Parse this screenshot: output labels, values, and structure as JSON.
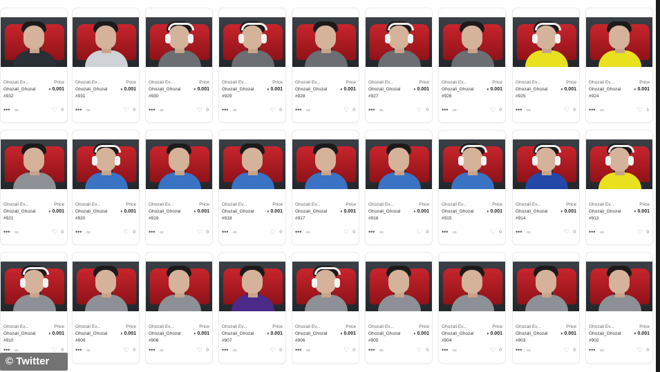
{
  "watermark": "© Twitter",
  "labels": {
    "price_label": "Price",
    "eth_icon": "ethereum-icon",
    "more_icon": "more-dots-icon",
    "link_icon": "link-icon",
    "heart_icon": "heart-icon"
  },
  "cards": [
    {
      "collection": "Ghozali Ev...",
      "owner": "Ghozali_Ghozal",
      "price": "0.001",
      "number": "#932",
      "likes": "0",
      "shirt": "#2b2f36",
      "headphones": false
    },
    {
      "collection": "Ghozali Ev...",
      "owner": "Ghozali_Ghozal",
      "price": "0.001",
      "number": "#931",
      "likes": "0",
      "shirt": "#cfd2d6",
      "headphones": false
    },
    {
      "collection": "Ghozali Ev...",
      "owner": "Ghozali_Ghozal",
      "price": "0.001",
      "number": "#930",
      "likes": "0",
      "shirt": "#6b6e72",
      "headphones": true
    },
    {
      "collection": "Ghozali Ev...",
      "owner": "Ghozali_Ghozal",
      "price": "0.001",
      "number": "#929",
      "likes": "0",
      "shirt": "#6b6e72",
      "headphones": true
    },
    {
      "collection": "Ghozali Ev...",
      "owner": "Ghozali_Ghozal",
      "price": "0.001",
      "number": "#928",
      "likes": "0",
      "shirt": "#6b6e72",
      "headphones": false
    },
    {
      "collection": "Ghozali Ev...",
      "owner": "Ghozali_Ghozal",
      "price": "0.001",
      "number": "#927",
      "likes": "0",
      "shirt": "#6b6e72",
      "headphones": true
    },
    {
      "collection": "Ghozali Ev...",
      "owner": "Ghozali_Ghozal",
      "price": "0.001",
      "number": "#926",
      "likes": "0",
      "shirt": "#6b6e72",
      "headphones": false
    },
    {
      "collection": "Ghozali Ev...",
      "owner": "Ghozali_Ghozal",
      "price": "0.001",
      "number": "#925",
      "likes": "0",
      "shirt": "#e9e11f",
      "headphones": true
    },
    {
      "collection": "Ghozali Ev...",
      "owner": "Ghozali_Ghozal",
      "price": "0.001",
      "number": "#924",
      "likes": "1",
      "shirt": "#e9e11f",
      "headphones": false
    },
    {
      "collection": "Ghozali Ev...",
      "owner": "Ghozali_Ghozal",
      "price": "0.001",
      "number": "#921",
      "likes": "0",
      "shirt": "#8d9096",
      "headphones": false
    },
    {
      "collection": "Ghozali Ev...",
      "owner": "Ghozali_Ghozal",
      "price": "0.001",
      "number": "#920",
      "likes": "0",
      "shirt": "#3a73c4",
      "headphones": true
    },
    {
      "collection": "Ghozali Ev...",
      "owner": "Ghozali_Ghozal",
      "price": "0.001",
      "number": "#919",
      "likes": "0",
      "shirt": "#3a73c4",
      "headphones": false
    },
    {
      "collection": "Ghozali Ev...",
      "owner": "Ghozali_Ghozal",
      "price": "0.001",
      "number": "#918",
      "likes": "0",
      "shirt": "#3a73c4",
      "headphones": false
    },
    {
      "collection": "Ghozali Ev...",
      "owner": "Ghozali_Ghozal",
      "price": "0.001",
      "number": "#917",
      "likes": "0",
      "shirt": "#3a73c4",
      "headphones": false
    },
    {
      "collection": "Ghozali Ev...",
      "owner": "Ghozali_Ghozal",
      "price": "0.001",
      "number": "#916",
      "likes": "0",
      "shirt": "#3a73c4",
      "headphones": false
    },
    {
      "collection": "Ghozali Ev...",
      "owner": "Ghozali_Ghozal",
      "price": "0.001",
      "number": "#915",
      "likes": "0",
      "shirt": "#3a73c4",
      "headphones": true
    },
    {
      "collection": "Ghozali Ev...",
      "owner": "Ghozali_Ghozal",
      "price": "0.001",
      "number": "#914",
      "likes": "0",
      "shirt": "#2448a8",
      "headphones": true
    },
    {
      "collection": "Ghozali Ev...",
      "owner": "Ghozali_Ghozal",
      "price": "0.001",
      "number": "#913",
      "likes": "0",
      "shirt": "#e9e11f",
      "headphones": true
    },
    {
      "collection": "Ghozali Ev...",
      "owner": "Ghozali_Ghozal",
      "price": "0.001",
      "number": "#910",
      "likes": "0",
      "shirt": "#8d9096",
      "headphones": true
    },
    {
      "collection": "Ghozali Ev...",
      "owner": "Ghozali_Ghozal",
      "price": "0.001",
      "number": "#909",
      "likes": "0",
      "shirt": "#8d9096",
      "headphones": false
    },
    {
      "collection": "Ghozali Ev...",
      "owner": "Ghozali_Ghozal",
      "price": "0.001",
      "number": "#908",
      "likes": "0",
      "shirt": "#8d9096",
      "headphones": false
    },
    {
      "collection": "Ghozali Ev...",
      "owner": "Ghozali_Ghozal",
      "price": "0.001",
      "number": "#907",
      "likes": "0",
      "shirt": "#4b2a8a",
      "headphones": false
    },
    {
      "collection": "Ghozali Ev...",
      "owner": "Ghozali_Ghozal",
      "price": "0.001",
      "number": "#906",
      "likes": "0",
      "shirt": "#8d9096",
      "headphones": true
    },
    {
      "collection": "Ghozali Ev...",
      "owner": "Ghozali_Ghozal",
      "price": "0.001",
      "number": "#905",
      "likes": "0",
      "shirt": "#8d9096",
      "headphones": false
    },
    {
      "collection": "Ghozali Ev...",
      "owner": "Ghozali_Ghozal",
      "price": "0.001",
      "number": "#904",
      "likes": "0",
      "shirt": "#8d9096",
      "headphones": false
    },
    {
      "collection": "Ghozali Ev...",
      "owner": "Ghozali_Ghozal",
      "price": "0.001",
      "number": "#903",
      "likes": "0",
      "shirt": "#8d9096",
      "headphones": false
    },
    {
      "collection": "Ghozali Ev...",
      "owner": "Ghozali_Ghozal",
      "price": "0.001",
      "number": "#902",
      "likes": "0",
      "shirt": "#8d9096",
      "headphones": false
    }
  ]
}
